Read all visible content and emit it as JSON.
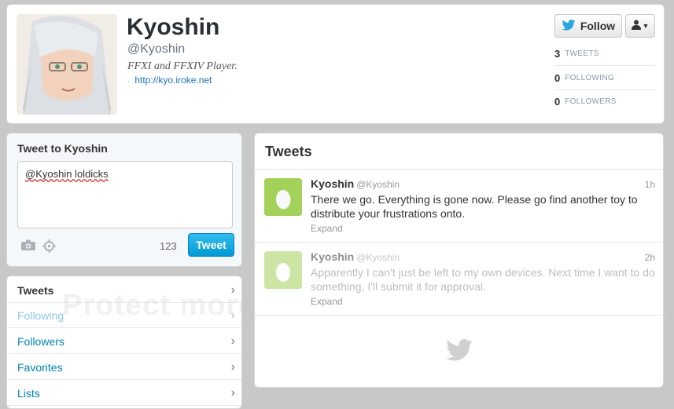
{
  "profile": {
    "name": "Kyoshin",
    "handle": "@Kyoshin",
    "bio": "FFXI and FFXIV Player.",
    "url": "http://kyo.iroke.net",
    "follow_label": "Follow",
    "stats": [
      {
        "count": "3",
        "label": "TWEETS"
      },
      {
        "count": "0",
        "label": "FOLLOWING"
      },
      {
        "count": "0",
        "label": "FOLLOWERS"
      }
    ]
  },
  "compose": {
    "title": "Tweet to Kyoshin",
    "text": "@Kyoshin loldicks",
    "char_count": "123",
    "tweet_label": "Tweet"
  },
  "nav": {
    "watermark": "Protect more of",
    "items": [
      "Tweets",
      "Following",
      "Followers",
      "Favorites",
      "Lists"
    ]
  },
  "timeline": {
    "title": "Tweets",
    "tweets": [
      {
        "name": "Kyoshin",
        "screen": "@Kyoshin",
        "time": "1h",
        "text": "There we go. Everything is gone now. Please go find another toy to distribute your frustrations onto.",
        "expand": "Expand"
      },
      {
        "name": "Kyoshin",
        "screen": "@Kyoshin",
        "time": "2h",
        "text": "Apparently I can't just be left to my own devices. Next time I want to do something, I'll submit it for approval.",
        "expand": "Expand"
      }
    ]
  },
  "colors": {
    "accent": "#019ad2",
    "link": "#0084b4",
    "egg": "#a3d15a"
  },
  "icons": [
    "twitter-bird-icon",
    "user-icon",
    "camera-icon",
    "location-icon",
    "chevron-right-icon",
    "egg-avatar-icon"
  ]
}
